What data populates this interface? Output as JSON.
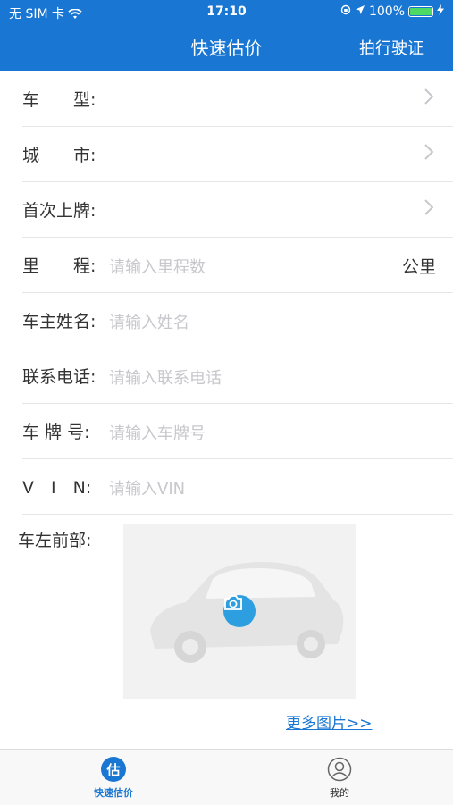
{
  "status_bar": {
    "carrier": "无 SIM 卡",
    "time": "17:10",
    "battery": "100%",
    "battery_level": 1.0
  },
  "header": {
    "title": "快速估价",
    "action": "拍行驶证"
  },
  "form": {
    "rows": [
      {
        "label": "车　　型:",
        "placeholder": "",
        "unit": ""
      },
      {
        "label": "城　　市:",
        "placeholder": "",
        "unit": ""
      },
      {
        "label": "首次上牌:",
        "placeholder": "",
        "unit": ""
      },
      {
        "label": "里　　程:",
        "placeholder": "请输入里程数",
        "unit": "公里"
      },
      {
        "label": "车主姓名:",
        "placeholder": "请输入姓名",
        "unit": ""
      },
      {
        "label": "联系电话:",
        "placeholder": "请输入联系电话",
        "unit": ""
      },
      {
        "label": "车 牌 号:",
        "placeholder": "请输入车牌号",
        "unit": ""
      },
      {
        "label": "V　I　N:",
        "placeholder": "请输入VIN",
        "unit": ""
      }
    ],
    "photo_label": "车左前部:",
    "more_link": "更多图片>>"
  },
  "tabbar": {
    "tabs": [
      {
        "label": "快速估价",
        "icon_text": "估",
        "active": true
      },
      {
        "label": "我的",
        "active": false
      }
    ]
  },
  "colors": {
    "accent": "#1976D2",
    "camera": "#2D9FE0",
    "placeholder": "#C7C7CC",
    "battery": "#4CD964"
  }
}
